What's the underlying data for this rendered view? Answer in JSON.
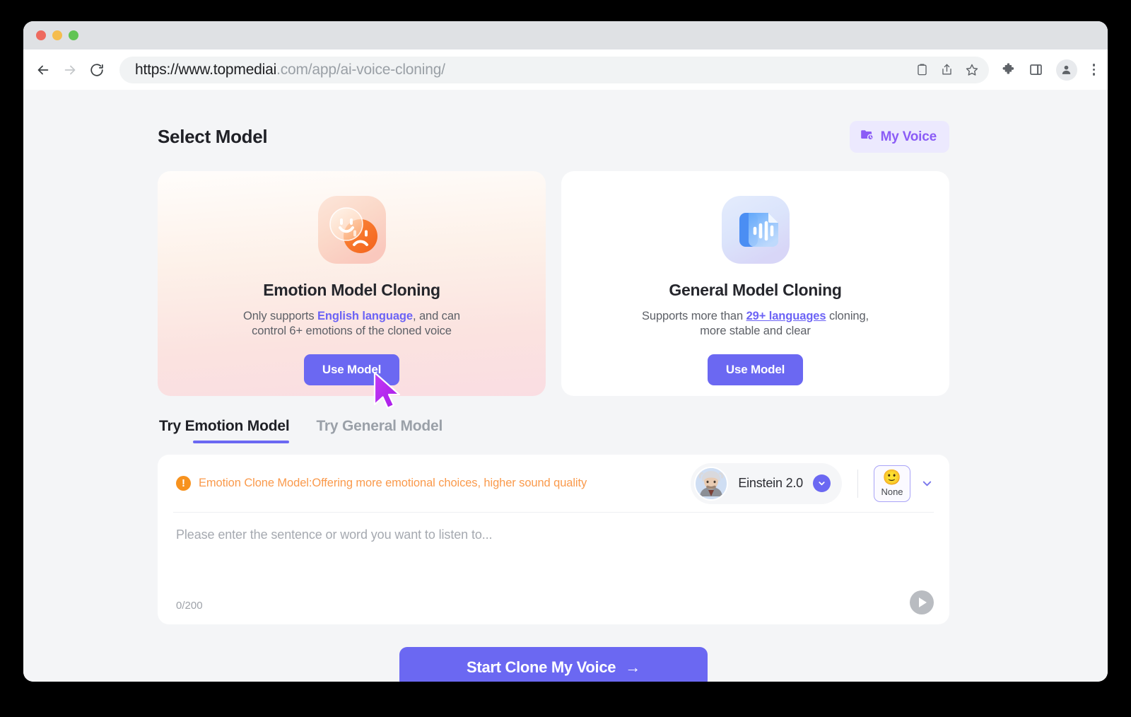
{
  "browser": {
    "url_bold": "https://www.topmediai",
    "url_rest": ".com/app/ai-voice-cloning/",
    "back_icon": "back-arrow-icon",
    "forward_icon": "forward-arrow-icon",
    "reload_icon": "reload-icon",
    "toolbar_icons": [
      "clipboard-icon",
      "share-icon",
      "bookmark-star-icon",
      "extensions-puzzle-icon",
      "side-panel-icon",
      "profile-avatar-icon",
      "more-menu-icon"
    ]
  },
  "page": {
    "title": "Select Model",
    "my_voice_label": "My Voice"
  },
  "models": [
    {
      "key": "emotion",
      "icon": "emotion-faces-icon",
      "title": "Emotion Model Cloning",
      "desc_pre": "Only supports ",
      "desc_link": "English language",
      "desc_post": ", and can",
      "desc_line2": "control 6+ emotions of the cloned voice",
      "button": "Use Model"
    },
    {
      "key": "general",
      "icon": "audio-document-icon",
      "title": "General Model Cloning",
      "desc_pre": "Supports more than ",
      "desc_link": "29+ languages",
      "desc_post": " cloning,",
      "desc_line2": "more stable and clear",
      "button": "Use Model"
    }
  ],
  "tabs": {
    "active_lead": "Try",
    "active_label": "Emotion Model",
    "inactive_label": "Try General Model"
  },
  "editor": {
    "notice_icon": "warning-exclamation-icon",
    "notice": "Emotion Clone Model:Offering more emotional choices, higher sound quality",
    "voice_name": "Einstein 2.0",
    "voice_avatar": "einstein-avatar",
    "emotion_emoji": "🙂",
    "emotion_label": "None",
    "placeholder": "Please enter the sentence or word you want to listen to...",
    "char_count": "0/200",
    "play_icon": "play-icon"
  },
  "cta": {
    "label": "Start Clone My Voice",
    "arrow": "→"
  },
  "colors": {
    "accent": "#6b68f2",
    "link": "#6c63f5",
    "notice": "#fa9a4c",
    "my_voice_bg": "#ece9fe",
    "cursor": "#b42cf0"
  }
}
